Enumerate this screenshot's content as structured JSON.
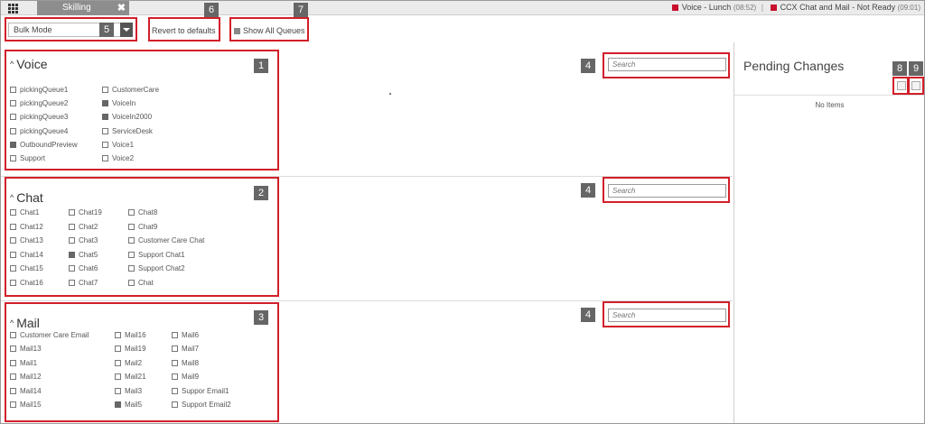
{
  "topbar": {
    "tab_label": "Skilling",
    "tab_close": "✖",
    "status1_label": "Voice - Lunch",
    "status1_time": "(08:52)",
    "status2_label": "CCX Chat and Mail - Not Ready",
    "status2_time": "(09:01)",
    "status_color": "#c8102e"
  },
  "toolbar": {
    "mode_value": "Bulk Mode",
    "revert_label": "Revert to defaults",
    "show_all_label": "Show All Queues"
  },
  "sections": [
    {
      "title": "Voice",
      "search_placeholder": "Search",
      "items": [
        {
          "label": "pickingQueue1",
          "checked": false
        },
        {
          "label": "pickingQueue2",
          "checked": false
        },
        {
          "label": "pickingQueue3",
          "checked": false
        },
        {
          "label": "pickingQueue4",
          "checked": false
        },
        {
          "label": "OutboundPreview",
          "checked": true
        },
        {
          "label": "Support",
          "checked": false
        },
        {
          "label": "CustomerCare",
          "checked": false
        },
        {
          "label": "VoiceIn",
          "checked": true
        },
        {
          "label": "VoiceIn2000",
          "checked": true
        },
        {
          "label": "ServiceDesk",
          "checked": false
        },
        {
          "label": "Voice1",
          "checked": false
        },
        {
          "label": "Voice2",
          "checked": false
        }
      ]
    },
    {
      "title": "Chat",
      "search_placeholder": "Search",
      "items": [
        {
          "label": "Chat1",
          "checked": false
        },
        {
          "label": "Chat12",
          "checked": false
        },
        {
          "label": "Chat13",
          "checked": false
        },
        {
          "label": "Chat14",
          "checked": false
        },
        {
          "label": "Chat15",
          "checked": false
        },
        {
          "label": "Chat16",
          "checked": false
        },
        {
          "label": "Chat19",
          "checked": false
        },
        {
          "label": "Chat2",
          "checked": false
        },
        {
          "label": "Chat3",
          "checked": false
        },
        {
          "label": "Chat5",
          "checked": true
        },
        {
          "label": "Chat6",
          "checked": false
        },
        {
          "label": "Chat7",
          "checked": false
        },
        {
          "label": "Chat8",
          "checked": false
        },
        {
          "label": "Chat9",
          "checked": false
        },
        {
          "label": "Customer Care Chat",
          "checked": false
        },
        {
          "label": "Support Chat1",
          "checked": false
        },
        {
          "label": "Support Chat2",
          "checked": false
        },
        {
          "label": "Chat",
          "checked": false
        }
      ]
    },
    {
      "title": "Mail",
      "search_placeholder": "Search",
      "items": [
        {
          "label": "Customer Care Email",
          "checked": false
        },
        {
          "label": "Mail13",
          "checked": false
        },
        {
          "label": "Mail1",
          "checked": false
        },
        {
          "label": "Mail12",
          "checked": false
        },
        {
          "label": "Mail14",
          "checked": false
        },
        {
          "label": "Mail15",
          "checked": false
        },
        {
          "label": "Mail16",
          "checked": false
        },
        {
          "label": "Mail19",
          "checked": false
        },
        {
          "label": "Mail2",
          "checked": false
        },
        {
          "label": "Mail21",
          "checked": false
        },
        {
          "label": "Mail3",
          "checked": false
        },
        {
          "label": "Mail5",
          "checked": true
        },
        {
          "label": "Mail6",
          "checked": false
        },
        {
          "label": "Mail7",
          "checked": false
        },
        {
          "label": "Mail8",
          "checked": false
        },
        {
          "label": "Mail9",
          "checked": false
        },
        {
          "label": "Suppor Email1",
          "checked": false
        },
        {
          "label": "Support Email2",
          "checked": false
        }
      ]
    }
  ],
  "pending": {
    "title": "Pending Changes",
    "empty_label": "No Items"
  },
  "annotations": {
    "color": "#d21f2a",
    "labels": [
      "1",
      "2",
      "3",
      "4",
      "4",
      "4",
      "5",
      "6",
      "7",
      "8",
      "9"
    ]
  }
}
